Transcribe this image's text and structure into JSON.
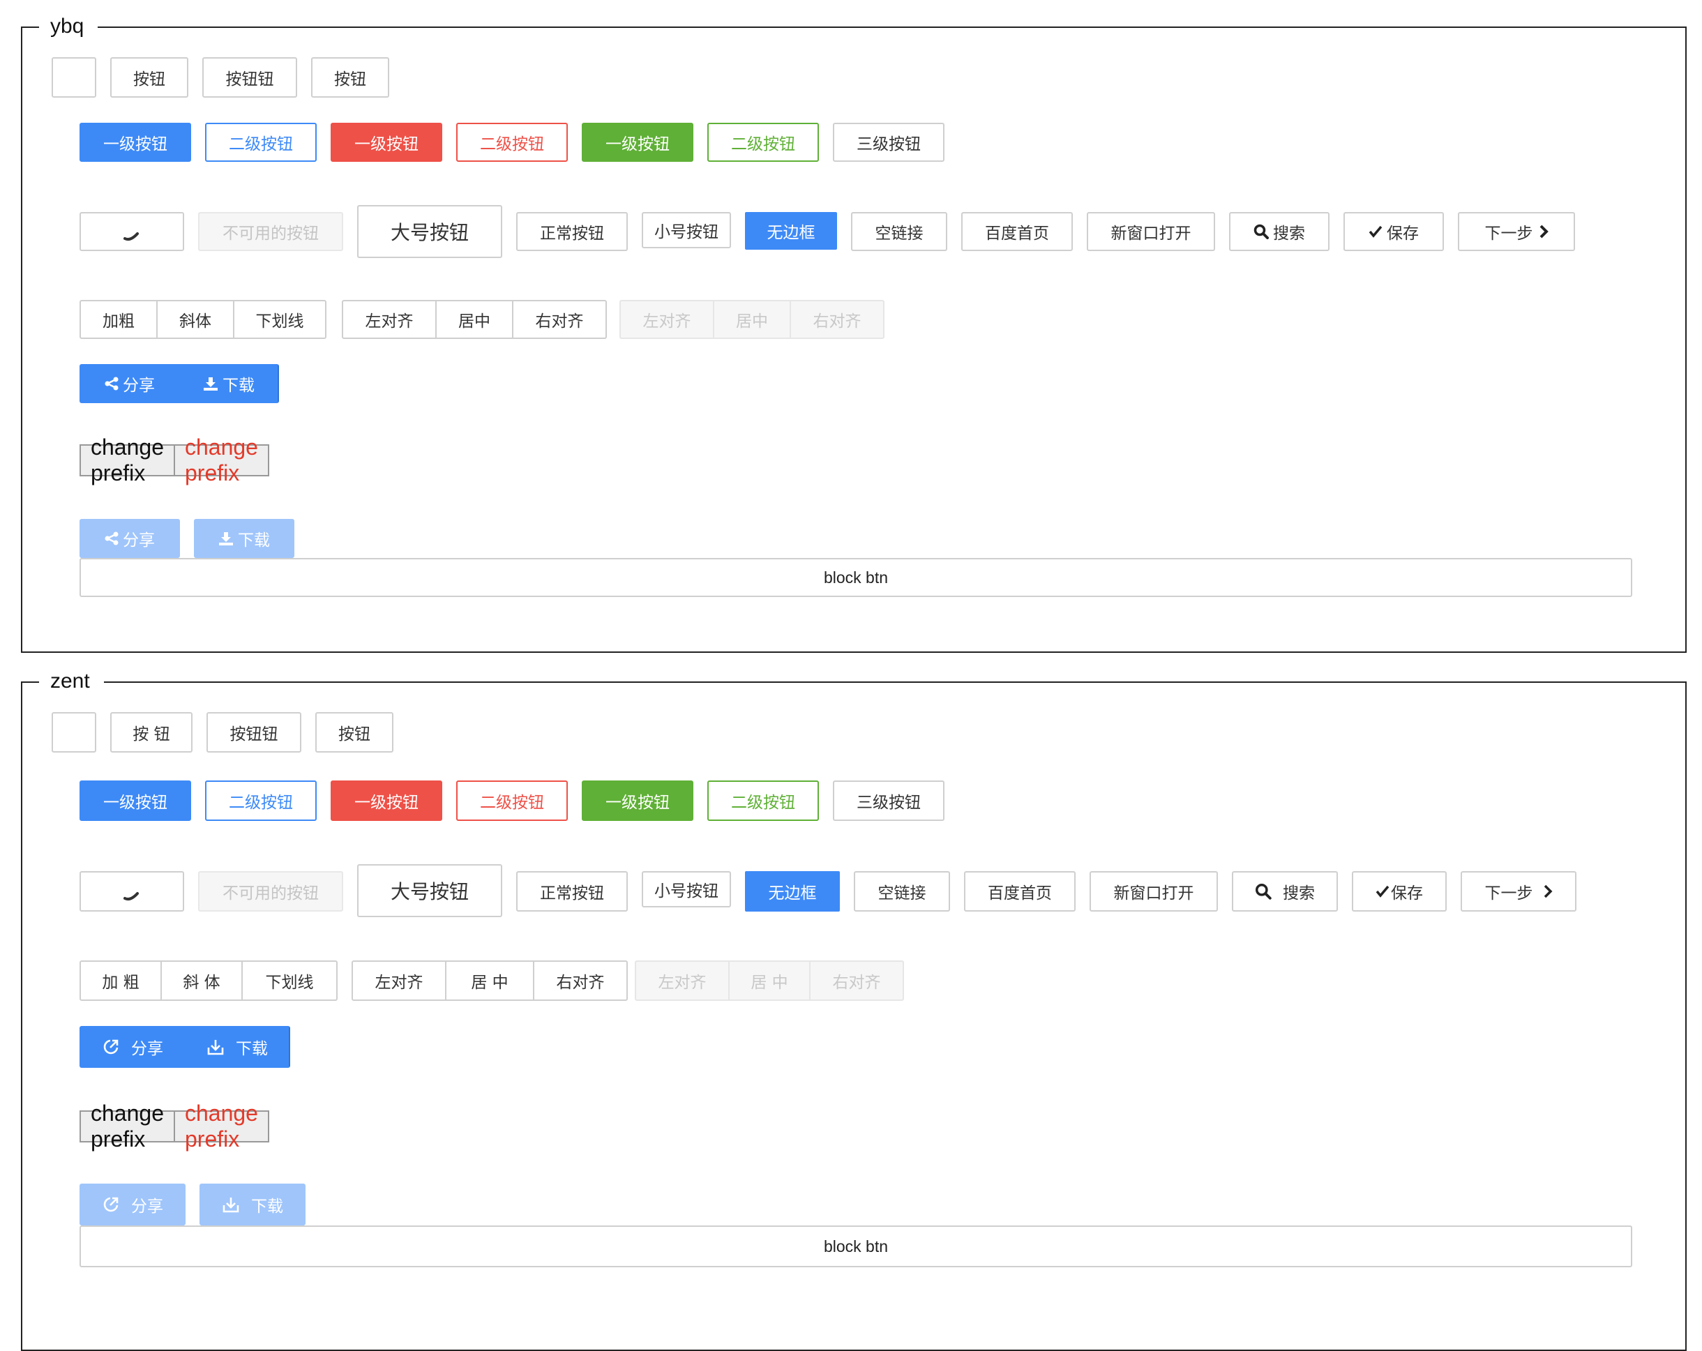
{
  "ybq": {
    "legend": "ybq",
    "row1": [
      "按钮",
      "按钮钮",
      "按钮"
    ],
    "row2": [
      "一级按钮",
      "二级按钮",
      "一级按钮",
      "二级按钮",
      "一级按钮",
      "二级按钮",
      "三级按钮"
    ],
    "row3": {
      "disabled": "不可用的按钮",
      "large": "大号按钮",
      "normal": "正常按钮",
      "small": "小号按钮",
      "borderless": "无边框",
      "empty_link": "空链接",
      "baidu": "百度首页",
      "new_window": "新窗口打开",
      "search": "搜索",
      "save": "保存",
      "next": "下一步"
    },
    "group_format": [
      "加粗",
      "斜体",
      "下划线"
    ],
    "group_align": [
      "左对齐",
      "居中",
      "右对齐"
    ],
    "group_align_disabled": [
      "左对齐",
      "居中",
      "右对齐"
    ],
    "share": "分享",
    "download": "下载",
    "prefix_1": "change prefix",
    "prefix_2": "change prefix",
    "share_disabled": "分享",
    "download_disabled": "下载",
    "block": "block btn"
  },
  "zent": {
    "legend": "zent",
    "row1": [
      "按 钮",
      "按钮钮",
      "按钮"
    ],
    "row2": [
      "一级按钮",
      "二级按钮",
      "一级按钮",
      "二级按钮",
      "一级按钮",
      "二级按钮",
      "三级按钮"
    ],
    "row3": {
      "disabled": "不可用的按钮",
      "large": "大号按钮",
      "normal": "正常按钮",
      "small": "小号按钮",
      "borderless": "无边框",
      "empty_link": "空链接",
      "baidu": "百度首页",
      "new_window": "新窗口打开",
      "search": "搜索",
      "save": "保存",
      "next": "下一步"
    },
    "group_format": [
      "加 粗",
      "斜 体",
      "下划线"
    ],
    "group_align": [
      "左对齐",
      "居 中",
      "右对齐"
    ],
    "group_align_disabled": [
      "左对齐",
      "居 中",
      "右对齐"
    ],
    "share": "分享",
    "download": "下载",
    "prefix_1": "change prefix",
    "prefix_2": "change prefix",
    "share_disabled": "分享",
    "download_disabled": "下载",
    "block": "block btn"
  },
  "colors": {
    "primary": "#3d8af7",
    "danger": "#ee5148",
    "success": "#5fb036",
    "prefix_red": "#e33a2a"
  },
  "icons": {
    "loading": "loading-spinner-icon",
    "search": "search-icon",
    "save": "checkmark-icon",
    "next": "chevron-right-icon",
    "share": "share-icon",
    "download": "download-icon"
  }
}
